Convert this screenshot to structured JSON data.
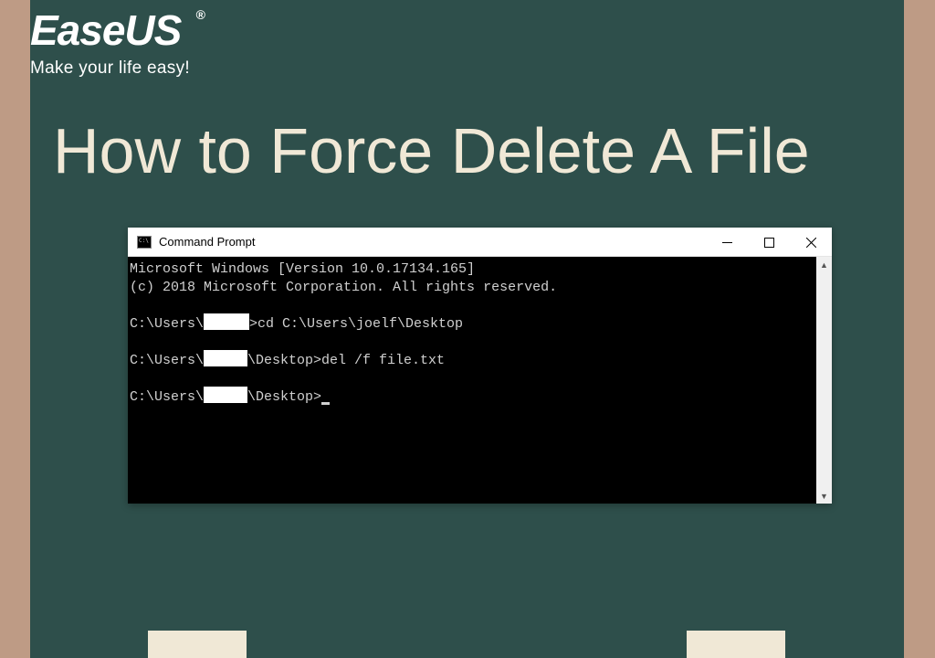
{
  "brand": {
    "name": "EaseUS",
    "registered": "®",
    "tagline": "Make your life easy!"
  },
  "page": {
    "title": "How to Force Delete A File"
  },
  "cmd": {
    "window_title": "Command Prompt",
    "lines": {
      "version": "Microsoft Windows [Version 10.0.17134.165]",
      "copyright": "(c) 2018 Microsoft Corporation. All rights reserved.",
      "prompt1_pre": "C:\\Users\\",
      "prompt1_post": ">cd C:\\Users\\joelf\\Desktop",
      "prompt2_pre": "C:\\Users\\",
      "prompt2_mid": "\\Desktop>del /f file.txt",
      "prompt3_pre": "C:\\Users\\",
      "prompt3_mid": "\\Desktop>"
    }
  }
}
